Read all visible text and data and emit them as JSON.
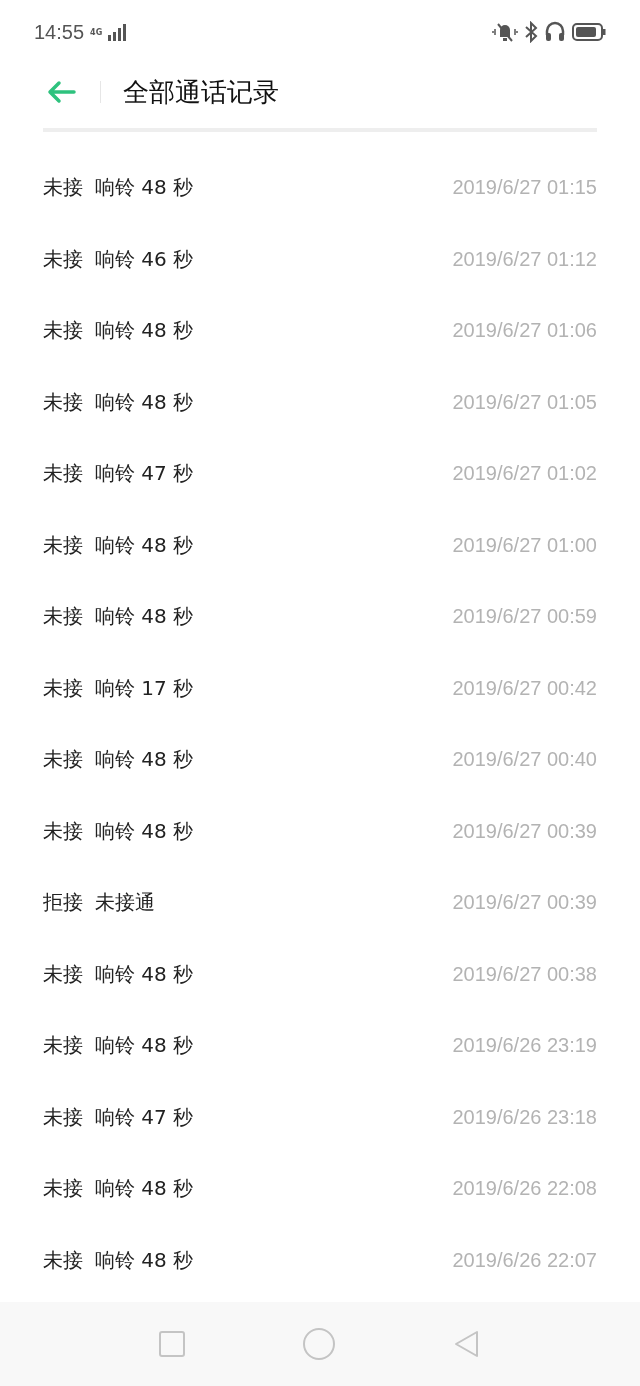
{
  "status_bar": {
    "time": "14:55",
    "network": "4G"
  },
  "header": {
    "title": "全部通话记录"
  },
  "calls": [
    {
      "status": "未接",
      "detail": "响铃 48 秒",
      "time": "2019/6/27 01:15"
    },
    {
      "status": "未接",
      "detail": "响铃 46 秒",
      "time": "2019/6/27 01:12"
    },
    {
      "status": "未接",
      "detail": "响铃 48 秒",
      "time": "2019/6/27 01:06"
    },
    {
      "status": "未接",
      "detail": "响铃 48 秒",
      "time": "2019/6/27 01:05"
    },
    {
      "status": "未接",
      "detail": "响铃 47 秒",
      "time": "2019/6/27 01:02"
    },
    {
      "status": "未接",
      "detail": "响铃 48 秒",
      "time": "2019/6/27 01:00"
    },
    {
      "status": "未接",
      "detail": "响铃 48 秒",
      "time": "2019/6/27 00:59"
    },
    {
      "status": "未接",
      "detail": "响铃 17 秒",
      "time": "2019/6/27 00:42"
    },
    {
      "status": "未接",
      "detail": "响铃 48 秒",
      "time": "2019/6/27 00:40"
    },
    {
      "status": "未接",
      "detail": "响铃 48 秒",
      "time": "2019/6/27 00:39"
    },
    {
      "status": "拒接",
      "detail": "未接通",
      "time": "2019/6/27 00:39"
    },
    {
      "status": "未接",
      "detail": "响铃 48 秒",
      "time": "2019/6/27 00:38"
    },
    {
      "status": "未接",
      "detail": "响铃 48 秒",
      "time": "2019/6/26 23:19"
    },
    {
      "status": "未接",
      "detail": "响铃 47 秒",
      "time": "2019/6/26 23:18"
    },
    {
      "status": "未接",
      "detail": "响铃 48 秒",
      "time": "2019/6/26 22:08"
    },
    {
      "status": "未接",
      "detail": "响铃 48 秒",
      "time": "2019/6/26 22:07"
    }
  ]
}
